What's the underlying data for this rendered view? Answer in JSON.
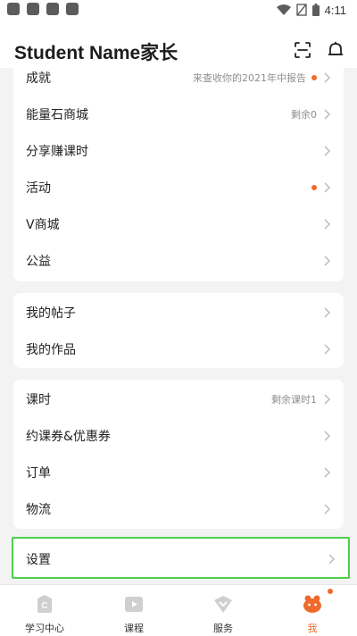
{
  "status_bar": {
    "time": "4:11",
    "icons": [
      "notification-icon",
      "notification-icon",
      "notification-icon",
      "notification-icon",
      "wifi-icon",
      "no-signal-icon",
      "battery-icon"
    ]
  },
  "header": {
    "title": "Student Name家长",
    "icons": [
      "scan-icon",
      "bell-icon"
    ]
  },
  "sections": [
    {
      "rows": [
        {
          "label": "成就",
          "extra": "来查收你的2021年中报告",
          "dot": true
        },
        {
          "label": "能量石商城",
          "extra": "剩余0",
          "dot": false
        },
        {
          "label": "分享赚课时",
          "extra": "",
          "dot": false
        },
        {
          "label": "活动",
          "extra": "",
          "dot": true
        },
        {
          "label": "V商城",
          "extra": "",
          "dot": false
        },
        {
          "label": "公益",
          "extra": "",
          "dot": false
        }
      ]
    },
    {
      "rows": [
        {
          "label": "我的帖子",
          "extra": "",
          "dot": false
        },
        {
          "label": "我的作品",
          "extra": "",
          "dot": false
        }
      ]
    },
    {
      "rows": [
        {
          "label": "课时",
          "extra": "剩余课时1",
          "dot": false
        },
        {
          "label": "约课券&优惠券",
          "extra": "",
          "dot": false
        },
        {
          "label": "订单",
          "extra": "",
          "dot": false
        },
        {
          "label": "物流",
          "extra": "",
          "dot": false
        }
      ]
    },
    {
      "rows": [
        {
          "label": "设置",
          "extra": "",
          "dot": false
        }
      ]
    }
  ],
  "tabbar": {
    "tabs": [
      {
        "label": "学习中心",
        "icon": "learning-center-icon",
        "active": false
      },
      {
        "label": "课程",
        "icon": "course-play-icon",
        "active": false
      },
      {
        "label": "服务",
        "icon": "service-heart-icon",
        "active": false
      },
      {
        "label": "我",
        "icon": "me-mascot-icon",
        "active": true
      }
    ]
  },
  "colors": {
    "accent": "#ef6a2d",
    "highlight_border": "#4cd04c",
    "background": "#f3f3f3"
  }
}
